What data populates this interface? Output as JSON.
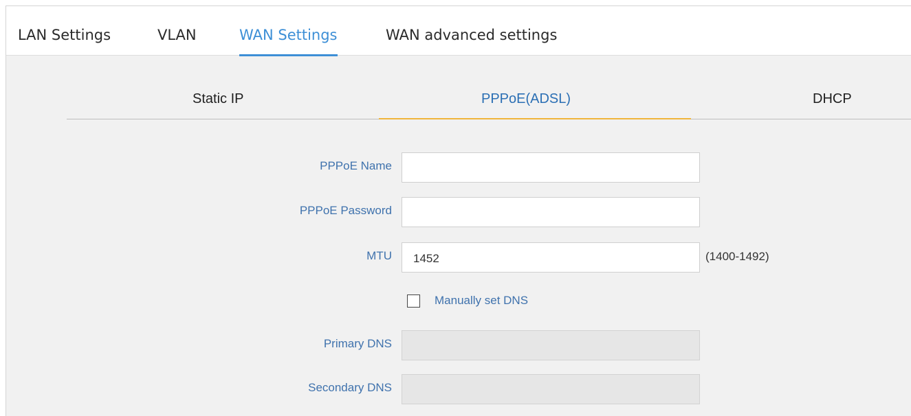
{
  "top_tabs": {
    "lan": "LAN Settings",
    "vlan": "VLAN",
    "wan": "WAN Settings",
    "wan_advanced": "WAN advanced settings",
    "active": "WAN Settings",
    "active_color": "#3d8fd6"
  },
  "connection_types": {
    "static": "Static IP",
    "pppoe": "PPPoE(ADSL)",
    "dhcp": "DHCP",
    "active": "PPPoE(ADSL)",
    "active_underline_color": "#f0b43a"
  },
  "form": {
    "pppoe_name": {
      "label": "PPPoE Name",
      "value": ""
    },
    "pppoe_password": {
      "label": "PPPoE Password",
      "value": ""
    },
    "mtu": {
      "label": "MTU",
      "value": "1452",
      "range_hint": "(1400-1492)"
    },
    "manual_dns": {
      "label": "Manually set DNS",
      "checked": false
    },
    "primary_dns": {
      "label": "Primary DNS",
      "value": "",
      "disabled": true
    },
    "secondary_dns": {
      "label": "Secondary DNS",
      "value": "",
      "disabled": true
    }
  }
}
